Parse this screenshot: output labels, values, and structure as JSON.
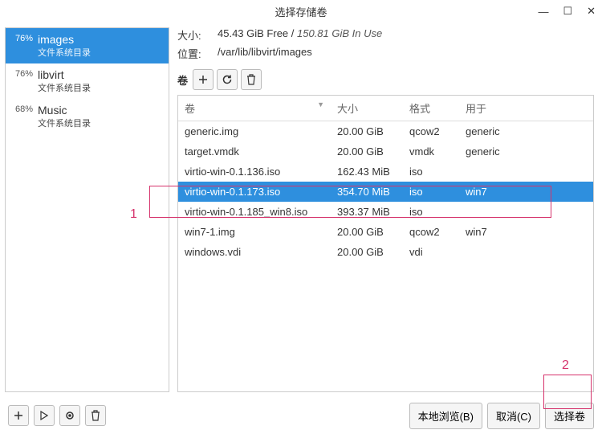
{
  "window": {
    "title": "选择存储卷"
  },
  "sidebar": {
    "pools": [
      {
        "pct": "76%",
        "name": "images",
        "type": "文件系统目录",
        "selected": true
      },
      {
        "pct": "76%",
        "name": "libvirt",
        "type": "文件系统目录",
        "selected": false
      },
      {
        "pct": "68%",
        "name": "Music",
        "type": "文件系统目录",
        "selected": false
      }
    ]
  },
  "info": {
    "size_label": "大小:",
    "free": "45.43 GiB Free",
    "sep": " / ",
    "inuse": "150.81 GiB In Use",
    "location_label": "位置:",
    "location": "/var/lib/libvirt/images"
  },
  "vol_toolbar": {
    "label": "卷"
  },
  "columns": {
    "name": "卷",
    "size": "大小",
    "format": "格式",
    "used_by": "用于"
  },
  "volumes": [
    {
      "name": "generic.img",
      "size": "20.00 GiB",
      "format": "qcow2",
      "used_by": "generic",
      "selected": false
    },
    {
      "name": "target.vmdk",
      "size": "20.00 GiB",
      "format": "vmdk",
      "used_by": "generic",
      "selected": false
    },
    {
      "name": "virtio-win-0.1.136.iso",
      "size": "162.43 MiB",
      "format": "iso",
      "used_by": "",
      "selected": false
    },
    {
      "name": "virtio-win-0.1.173.iso",
      "size": "354.70 MiB",
      "format": "iso",
      "used_by": "win7",
      "selected": true
    },
    {
      "name": "virtio-win-0.1.185_win8.iso",
      "size": "393.37 MiB",
      "format": "iso",
      "used_by": "",
      "selected": false
    },
    {
      "name": "win7-1.img",
      "size": "20.00 GiB",
      "format": "qcow2",
      "used_by": "win7",
      "selected": false
    },
    {
      "name": "windows.vdi",
      "size": "20.00 GiB",
      "format": "vdi",
      "used_by": "",
      "selected": false
    }
  ],
  "buttons": {
    "browse_local": "本地浏览(B)",
    "cancel": "取消(C)",
    "choose": "选择卷"
  },
  "annotations": {
    "a1": "1",
    "a2": "2"
  }
}
